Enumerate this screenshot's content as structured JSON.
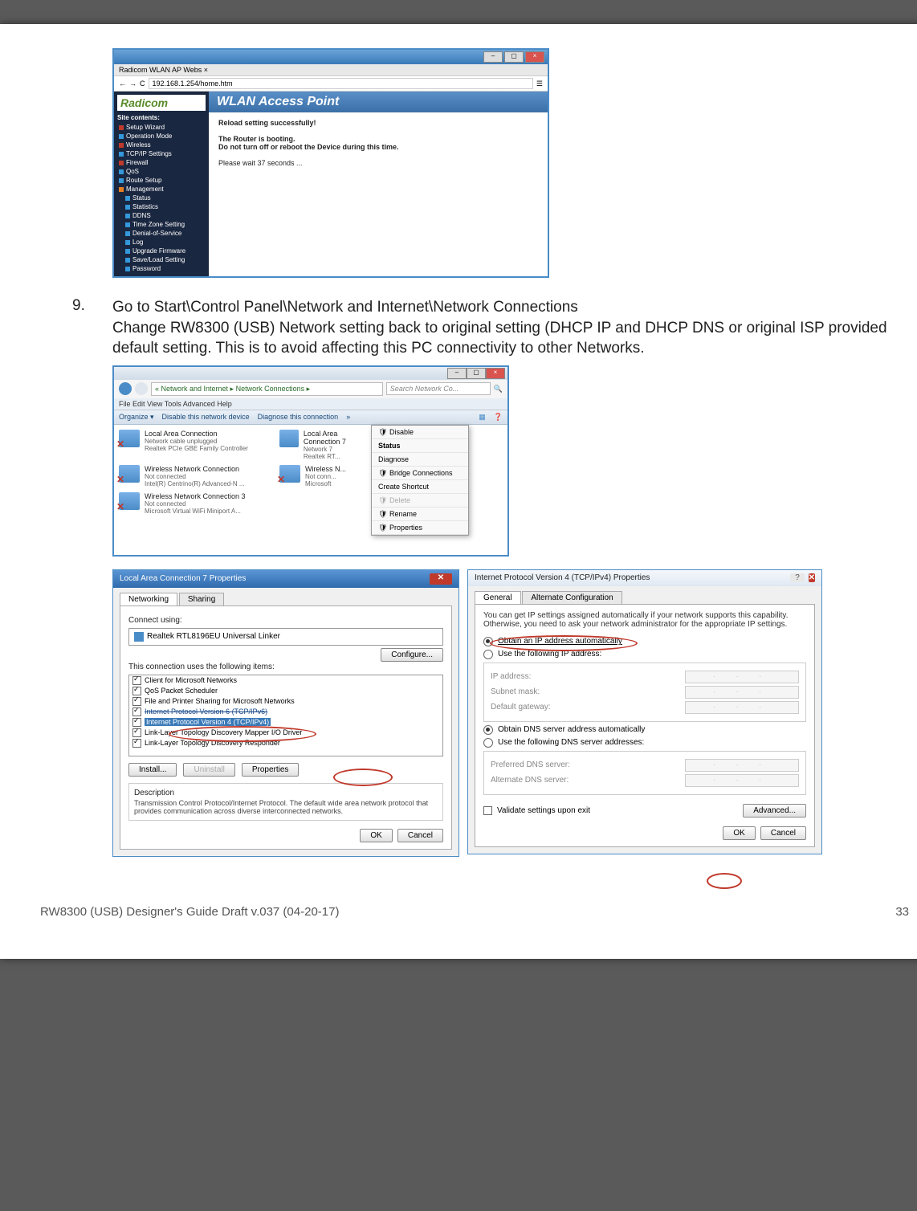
{
  "browser": {
    "tab": "Radicom WLAN AP Webs  ×",
    "url": "192.168.1.254/home.htm",
    "logo": "Radicom",
    "title": "WLAN Access Point",
    "msg1": "Reload setting successfully!",
    "msg2": "The Router is booting.",
    "msg3": "Do not turn off or reboot the Device during this time.",
    "msg4": "Please wait 37 seconds ...",
    "sidebar": {
      "heading": "Site contents:",
      "items": [
        "Setup Wizard",
        "Operation Mode",
        "Wireless",
        "TCP/IP Settings",
        "Firewall",
        "QoS",
        "Route Setup",
        "Management"
      ],
      "subitems": [
        "Status",
        "Statistics",
        "DDNS",
        "Time Zone Setting",
        "Denial-of-Service",
        "Log",
        "Upgrade Firmware",
        "Save/Load Setting",
        "Password"
      ]
    }
  },
  "step": {
    "num": "9.",
    "line1": "Go to Start\\Control Panel\\Network and Internet\\Network Connections",
    "line2": "Change RW8300 (USB) Network setting back to original setting (DHCP IP and DHCP DNS or original ISP provided default setting. This is to avoid affecting this PC connectivity to other Networks."
  },
  "netwin": {
    "path": "« Network and Internet ▸ Network Connections ▸",
    "search_ph": "Search Network Co...",
    "menu": "File   Edit   View   Tools   Advanced   Help",
    "toolbar": {
      "organize": "Organize ▾",
      "disable": "Disable this network device",
      "diagnose": "Diagnose this connection",
      "more": "»"
    },
    "conns": [
      {
        "t1": "Local Area Connection",
        "t2": "Network cable unplugged",
        "t3": "Realtek PCIe GBE Family Controller",
        "x": true
      },
      {
        "t1": "Local Area Connection 7",
        "t2": "Network 7",
        "t3": "Realtek RT...",
        "x": false
      },
      {
        "t1": "Wireless Network Connection",
        "t2": "Not connected",
        "t3": "Intel(R) Centrino(R) Advanced-N ...",
        "x": true
      },
      {
        "t1": "Wireless N...",
        "t2": "Not conn...",
        "t3": "Microsoft",
        "x": true
      },
      {
        "t1": "Wireless Network Connection 3",
        "t2": "Not connected",
        "t3": "Microsoft Virtual WiFi Miniport A...",
        "x": true
      }
    ],
    "context": [
      "Disable",
      "Status",
      "Diagnose",
      "Bridge Connections",
      "Create Shortcut",
      "Delete",
      "Rename",
      "Properties"
    ]
  },
  "dlg1": {
    "title": "Local Area Connection 7 Properties",
    "tab1": "Networking",
    "tab2": "Sharing",
    "connect_using": "Connect using:",
    "adapter": "Realtek RTL8196EU Universal Linker",
    "configure": "Configure...",
    "uses_label": "This connection uses the following items:",
    "items": [
      "Client for Microsoft Networks",
      "QoS Packet Scheduler",
      "File and Printer Sharing for Microsoft Networks",
      "Internet Protocol Version 6 (TCP/IPv6)",
      "Internet Protocol Version 4 (TCP/IPv4)",
      "Link-Layer Topology Discovery Mapper I/O Driver",
      "Link-Layer Topology Discovery Responder"
    ],
    "install": "Install...",
    "uninstall": "Uninstall",
    "properties": "Properties",
    "desc_label": "Description",
    "desc": "Transmission Control Protocol/Internet Protocol. The default wide area network protocol that provides communication across diverse interconnected networks.",
    "ok": "OK",
    "cancel": "Cancel"
  },
  "dlg2": {
    "title": "Internet Protocol Version 4 (TCP/IPv4) Properties",
    "tab1": "General",
    "tab2": "Alternate Configuration",
    "intro": "You can get IP settings assigned automatically if your network supports this capability. Otherwise, you need to ask your network administrator for the appropriate IP settings.",
    "r1": "Obtain an IP address automatically",
    "r2": "Use the following IP address:",
    "ip": "IP address:",
    "subnet": "Subnet mask:",
    "gateway": "Default gateway:",
    "r3": "Obtain DNS server address automatically",
    "r4": "Use the following DNS server addresses:",
    "pdns": "Preferred DNS server:",
    "adns": "Alternate DNS server:",
    "validate": "Validate settings upon exit",
    "advanced": "Advanced...",
    "ok": "OK",
    "cancel": "Cancel"
  },
  "footer": {
    "left": "RW8300 (USB) Designer's Guide Draft v.037 (04-20-17)",
    "right": "33"
  }
}
